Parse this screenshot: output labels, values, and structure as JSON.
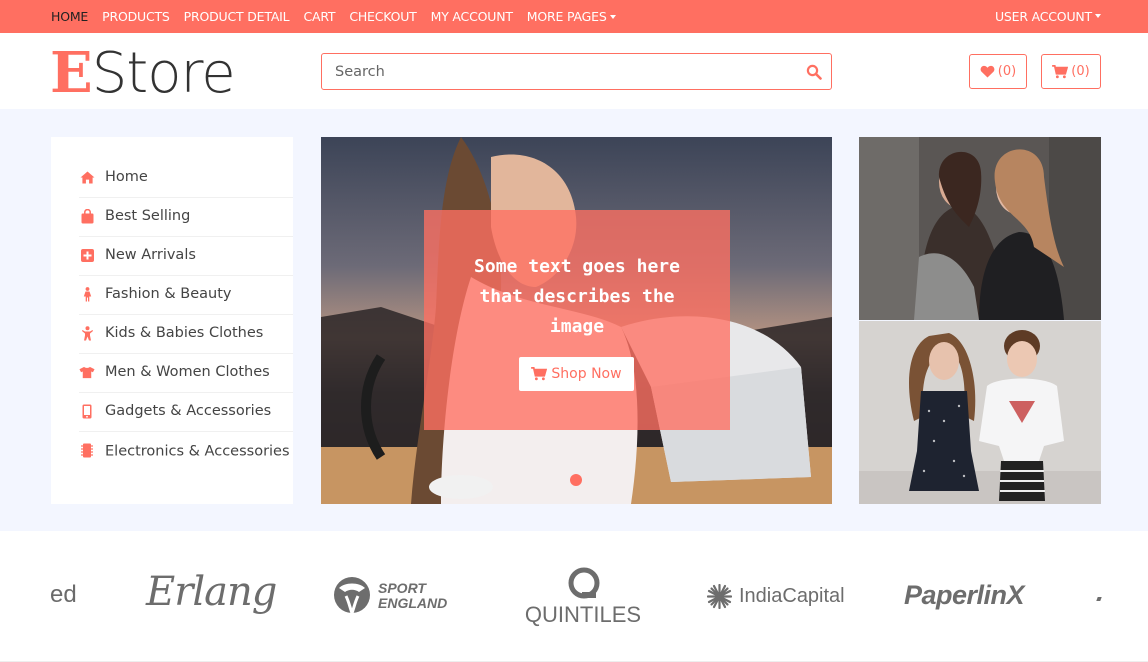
{
  "topnav": {
    "items": [
      {
        "label": "HOME",
        "active": true
      },
      {
        "label": "PRODUCTS"
      },
      {
        "label": "PRODUCT DETAIL"
      },
      {
        "label": "CART"
      },
      {
        "label": "CHECKOUT"
      },
      {
        "label": "MY ACCOUNT"
      },
      {
        "label": "MORE PAGES"
      }
    ],
    "user_account": "USER ACCOUNT"
  },
  "header": {
    "logo_first": "E",
    "logo_rest": "Store",
    "search_placeholder": "Search",
    "wishlist_count": "(0)",
    "cart_count": "(0)"
  },
  "sidebar": {
    "items": [
      {
        "label": "Home",
        "icon": "home-icon"
      },
      {
        "label": "Best Selling",
        "icon": "shopping-bag-icon"
      },
      {
        "label": "New Arrivals",
        "icon": "plus-square-icon"
      },
      {
        "label": "Fashion & Beauty",
        "icon": "female-icon"
      },
      {
        "label": "Kids & Babies Clothes",
        "icon": "child-icon"
      },
      {
        "label": "Men & Women Clothes",
        "icon": "tshirt-icon"
      },
      {
        "label": "Gadgets & Accessories",
        "icon": "mobile-icon"
      },
      {
        "label": "Electronics & Accessories",
        "icon": "microchip-icon"
      }
    ]
  },
  "slider": {
    "caption": "Some text goes here that describes the image",
    "caption_lines": [
      "Some text goes here",
      "that describes the",
      "image"
    ],
    "button": "Shop Now"
  },
  "brands": {
    "items": [
      "ed",
      "Erlang",
      "SPORT",
      "ENGLAND",
      "QUINTILES",
      "IndiaCapital",
      "PaperlinX"
    ]
  },
  "colors": {
    "accent": "#ff6f61",
    "bg_light": "#f3f6ff",
    "text": "#444444"
  }
}
